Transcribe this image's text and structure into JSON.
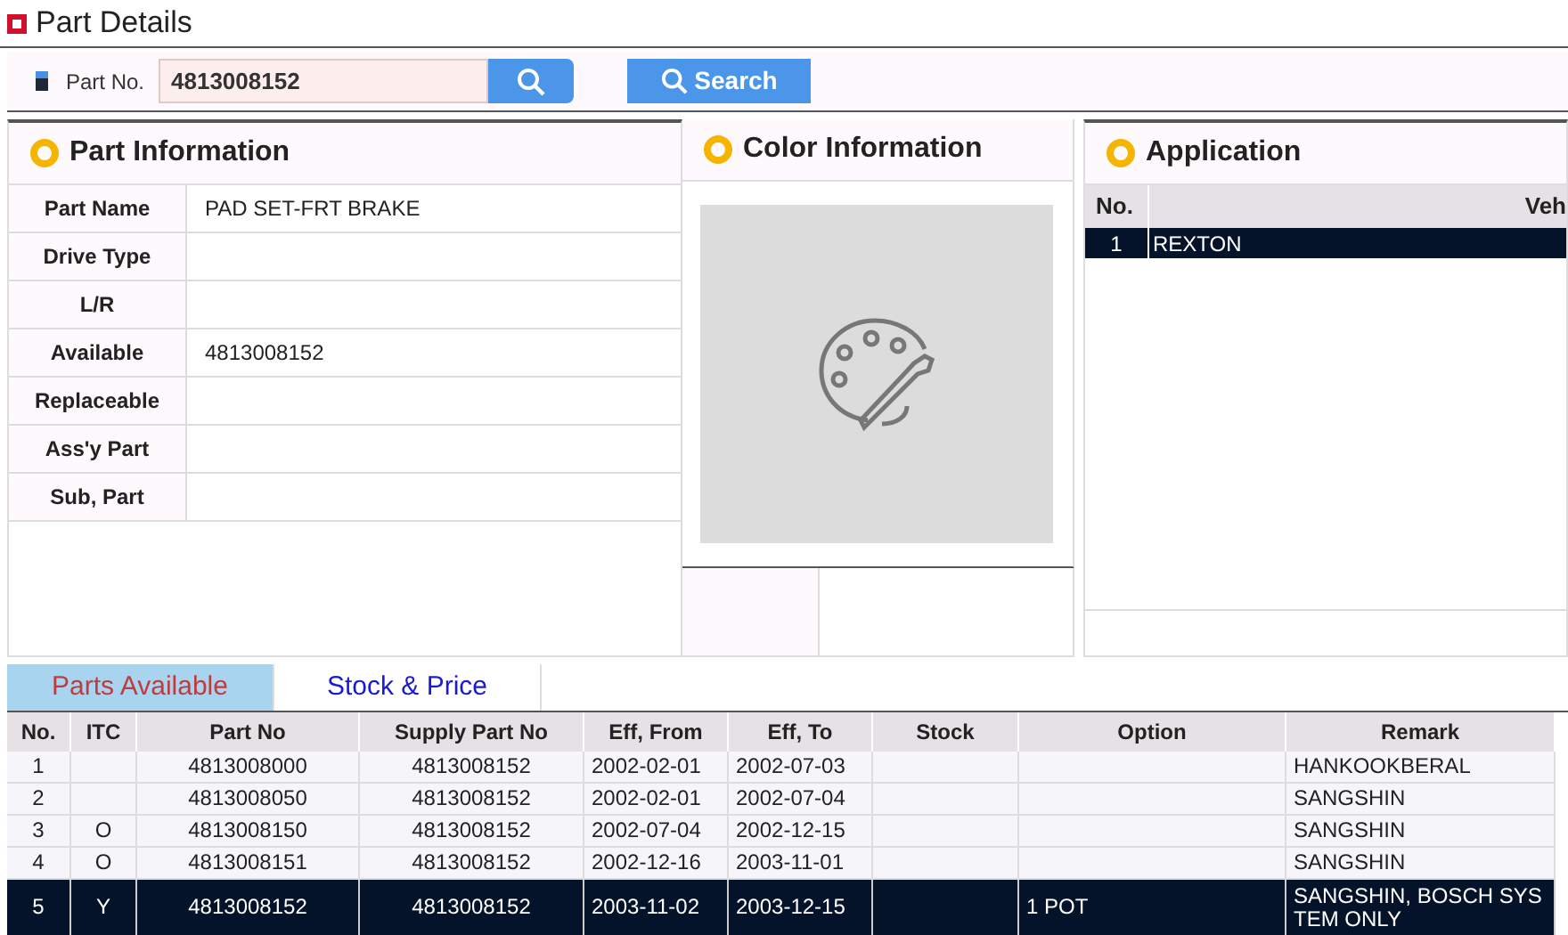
{
  "page_title": "Part Details",
  "search": {
    "label": "Part No.",
    "value": "4813008152",
    "button": "Search"
  },
  "part_information": {
    "title": "Part Information",
    "fields": [
      {
        "label": "Part Name",
        "value": "PAD SET-FRT BRAKE"
      },
      {
        "label": "Drive Type"
      },
      {
        "label": "L/R"
      },
      {
        "label": "Available",
        "value": "4813008152"
      },
      {
        "label": "Replaceable"
      },
      {
        "label": "Ass'y Part"
      },
      {
        "label": "Sub, Part"
      }
    ]
  },
  "color_information": {
    "title": "Color Information"
  },
  "application": {
    "title": "Application",
    "columns": [
      "No.",
      "Veh"
    ],
    "rows": [
      {
        "no": "1",
        "vehicle": "REXTON",
        "selected": true
      }
    ]
  },
  "tabs": [
    {
      "label": "Parts Available",
      "selected": true
    },
    {
      "label": "Stock & Price",
      "selected": false
    }
  ],
  "table": {
    "columns": [
      "No.",
      "ITC",
      "Part No",
      "Supply Part No",
      "Eff, From",
      "Eff, To",
      "Stock",
      "Option",
      "Remark"
    ],
    "rows": [
      {
        "cells": [
          "1",
          "",
          "4813008000",
          "4813008152",
          "2002-02-01",
          "2002-07-03",
          "",
          "",
          "HANKOOKBERAL"
        ],
        "selected": false
      },
      {
        "cells": [
          "2",
          "",
          "4813008050",
          "4813008152",
          "2002-02-01",
          "2002-07-04",
          "",
          "",
          "SANGSHIN"
        ],
        "selected": false
      },
      {
        "cells": [
          "3",
          "O",
          "4813008150",
          "4813008152",
          "2002-07-04",
          "2002-12-15",
          "",
          "",
          "SANGSHIN"
        ],
        "selected": false
      },
      {
        "cells": [
          "4",
          "O",
          "4813008151",
          "4813008152",
          "2002-12-16",
          "2003-11-01",
          "",
          "",
          "SANGSHIN"
        ],
        "selected": false
      },
      {
        "cells": [
          "5",
          "Y",
          "4813008152",
          "4813008152",
          "2003-11-02",
          "2003-12-15",
          "",
          "1 POT",
          "SANGSHIN, BOSCH SYSTEM ONLY"
        ],
        "selected": true
      }
    ]
  }
}
